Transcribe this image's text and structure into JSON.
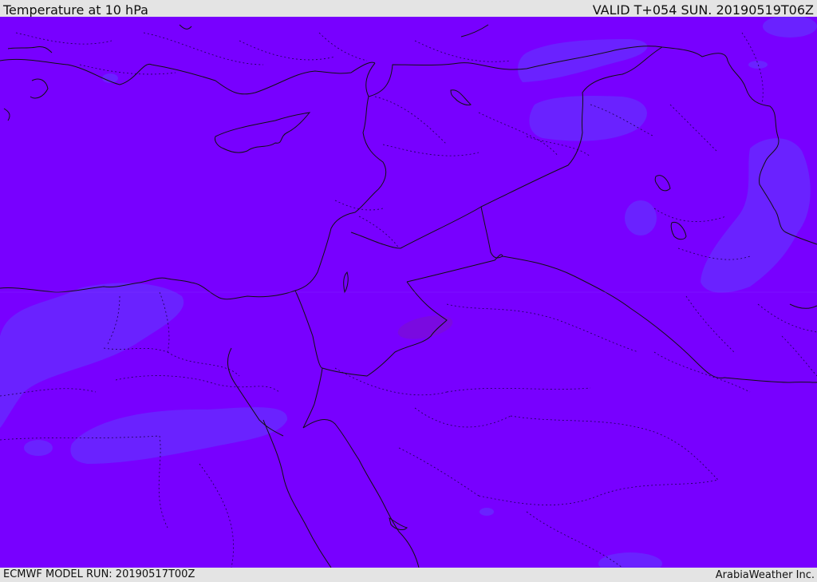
{
  "header": {
    "title": "Temperature at 10 hPa",
    "valid": "VALID T+054 SUN. 20190519T06Z"
  },
  "footer": {
    "model_run": "ECMWF MODEL RUN: 20190517T00Z",
    "credit": "ArabiaWeather Inc."
  },
  "map": {
    "colors": {
      "background_field": "#7800ff",
      "slightly_cooler_field": "#6a22ff",
      "slightly_warmer_field": "#7a0ae0",
      "coastline_border": "#111111"
    }
  }
}
